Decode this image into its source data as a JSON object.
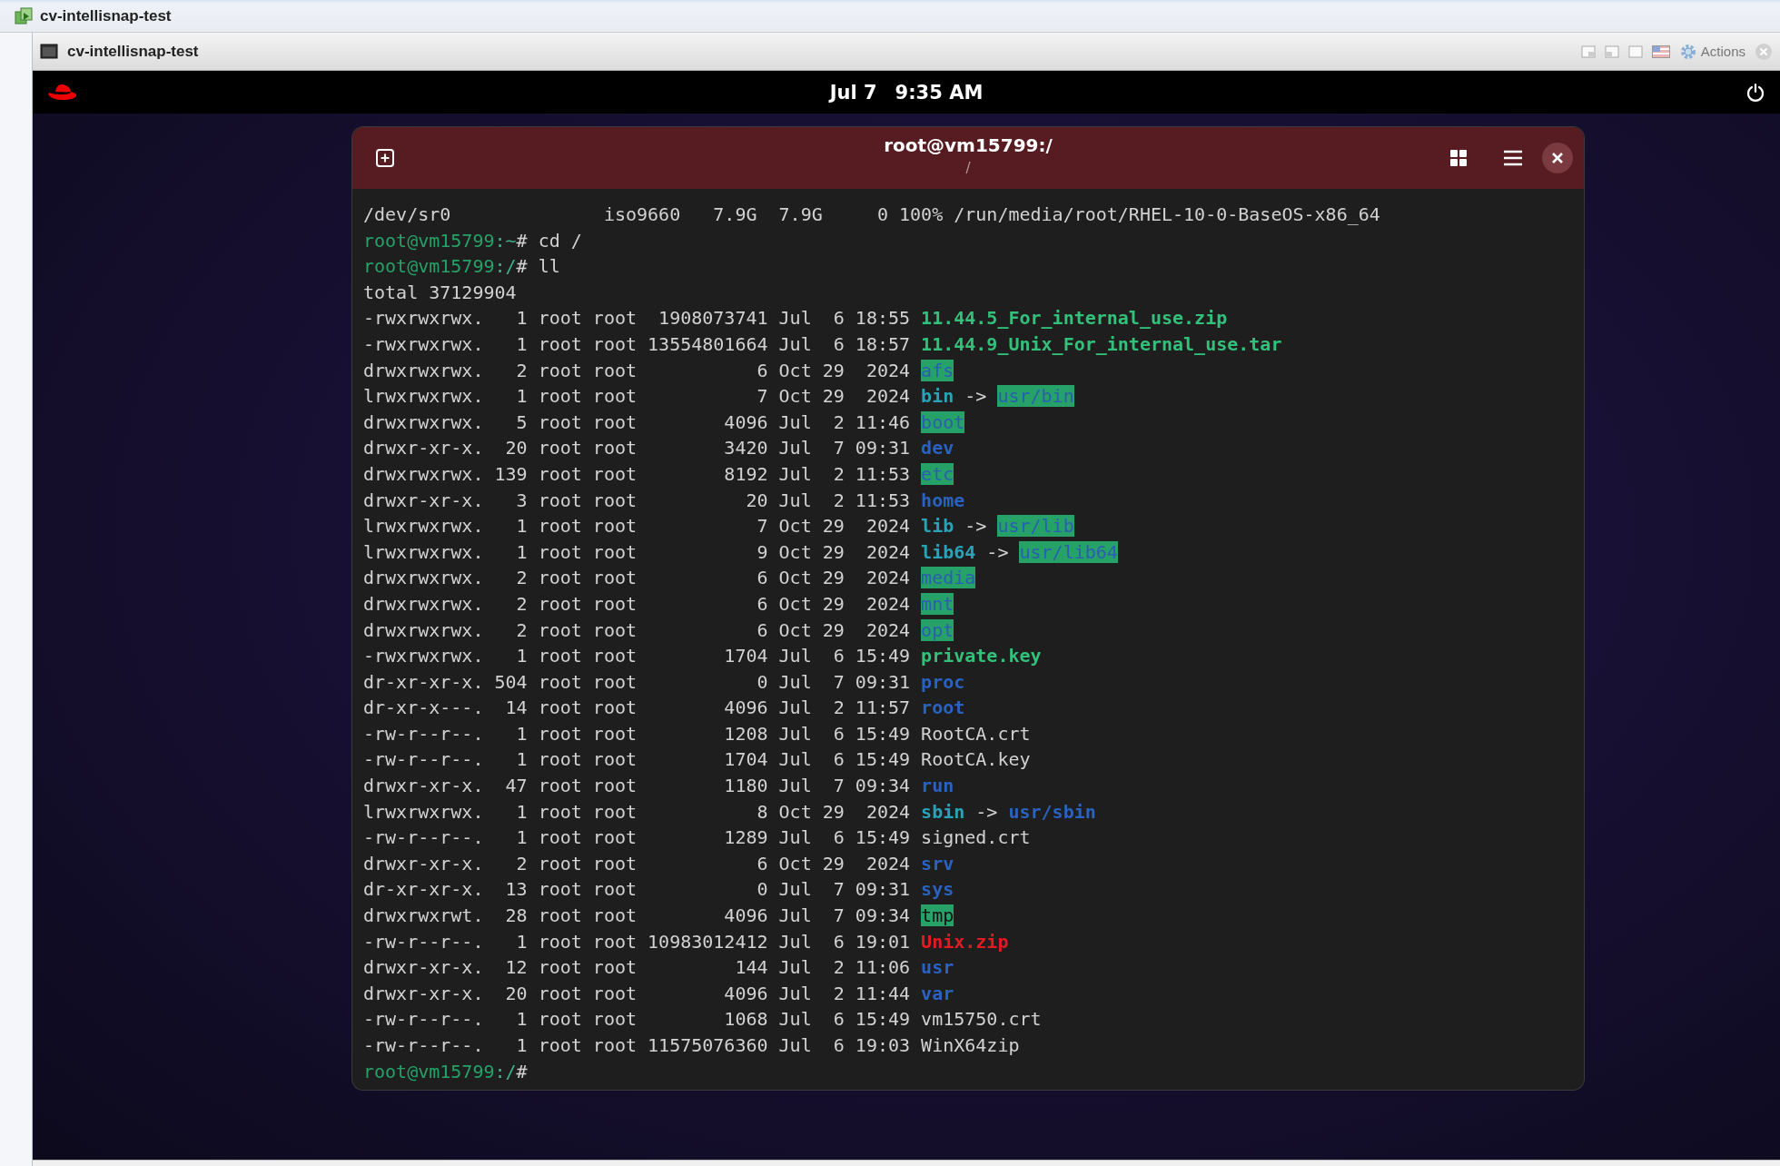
{
  "window": {
    "title": "cv-intellisnap-test"
  },
  "vm_window": {
    "title": "cv-intellisnap-test",
    "actions_label": "Actions"
  },
  "top_bar": {
    "date": "Jul 7",
    "time": "9:35 AM"
  },
  "terminal": {
    "title": "root@vm15799:/",
    "subtitle": "/",
    "lines": [
      [
        {
          "text": "/dev/sr0              iso9660   7.9G  7.9G     0 100% /run/media/root/RHEL-10-0-BaseOS-x86_64",
          "kind": "plain"
        }
      ],
      [
        {
          "text": "root@vm15799",
          "kind": "prompt-user"
        },
        {
          "text": ":~",
          "kind": "prompt-path"
        },
        {
          "text": "# cd /",
          "kind": "plain"
        }
      ],
      [
        {
          "text": "root@vm15799",
          "kind": "prompt-user"
        },
        {
          "text": ":/",
          "kind": "prompt-path"
        },
        {
          "text": "# ll",
          "kind": "plain"
        }
      ],
      [
        {
          "text": "total 37129904",
          "kind": "plain"
        }
      ],
      [
        {
          "text": "-rwxrwxrwx.   1 root root  1908073741 Jul  6 18:55 ",
          "kind": "plain"
        },
        {
          "text": "11.44.5_For_internal_use.zip",
          "kind": "exec"
        }
      ],
      [
        {
          "text": "-rwxrwxrwx.   1 root root 13554801664 Jul  6 18:57 ",
          "kind": "plain"
        },
        {
          "text": "11.44.9_Unix_For_internal_use.tar",
          "kind": "exec"
        }
      ],
      [
        {
          "text": "drwxrwxrwx.   2 root root           6 Oct 29  2024 ",
          "kind": "plain"
        },
        {
          "text": "afs",
          "kind": "dir-other"
        }
      ],
      [
        {
          "text": "lrwxrwxrwx.   1 root root           7 Oct 29  2024 ",
          "kind": "plain"
        },
        {
          "text": "bin",
          "kind": "link"
        },
        {
          "text": " -> ",
          "kind": "plain"
        },
        {
          "text": "usr/bin",
          "kind": "dir-other"
        }
      ],
      [
        {
          "text": "drwxrwxrwx.   5 root root        4096 Jul  2 11:46 ",
          "kind": "plain"
        },
        {
          "text": "boot",
          "kind": "dir-other"
        }
      ],
      [
        {
          "text": "drwxr-xr-x.  20 root root        3420 Jul  7 09:31 ",
          "kind": "plain"
        },
        {
          "text": "dev",
          "kind": "dir"
        }
      ],
      [
        {
          "text": "drwxrwxrwx. 139 root root        8192 Jul  2 11:53 ",
          "kind": "plain"
        },
        {
          "text": "etc",
          "kind": "dir-other"
        }
      ],
      [
        {
          "text": "drwxr-xr-x.   3 root root          20 Jul  2 11:53 ",
          "kind": "plain"
        },
        {
          "text": "home",
          "kind": "dir"
        }
      ],
      [
        {
          "text": "lrwxrwxrwx.   1 root root           7 Oct 29  2024 ",
          "kind": "plain"
        },
        {
          "text": "lib",
          "kind": "link"
        },
        {
          "text": " -> ",
          "kind": "plain"
        },
        {
          "text": "usr/lib",
          "kind": "dir-other"
        }
      ],
      [
        {
          "text": "lrwxrwxrwx.   1 root root           9 Oct 29  2024 ",
          "kind": "plain"
        },
        {
          "text": "lib64",
          "kind": "link"
        },
        {
          "text": " -> ",
          "kind": "plain"
        },
        {
          "text": "usr/lib64",
          "kind": "dir-other"
        }
      ],
      [
        {
          "text": "drwxrwxrwx.   2 root root           6 Oct 29  2024 ",
          "kind": "plain"
        },
        {
          "text": "media",
          "kind": "dir-other"
        }
      ],
      [
        {
          "text": "drwxrwxrwx.   2 root root           6 Oct 29  2024 ",
          "kind": "plain"
        },
        {
          "text": "mnt",
          "kind": "dir-other"
        }
      ],
      [
        {
          "text": "drwxrwxrwx.   2 root root           6 Oct 29  2024 ",
          "kind": "plain"
        },
        {
          "text": "opt",
          "kind": "dir-other"
        }
      ],
      [
        {
          "text": "-rwxrwxrwx.   1 root root        1704 Jul  6 15:49 ",
          "kind": "plain"
        },
        {
          "text": "private.key",
          "kind": "exec"
        }
      ],
      [
        {
          "text": "dr-xr-xr-x. 504 root root           0 Jul  7 09:31 ",
          "kind": "plain"
        },
        {
          "text": "proc",
          "kind": "dir"
        }
      ],
      [
        {
          "text": "dr-xr-x---.  14 root root        4096 Jul  2 11:57 ",
          "kind": "plain"
        },
        {
          "text": "root",
          "kind": "dir"
        }
      ],
      [
        {
          "text": "-rw-r--r--.   1 root root        1208 Jul  6 15:49 RootCA.crt",
          "kind": "plain"
        }
      ],
      [
        {
          "text": "-rw-r--r--.   1 root root        1704 Jul  6 15:49 RootCA.key",
          "kind": "plain"
        }
      ],
      [
        {
          "text": "drwxr-xr-x.  47 root root        1180 Jul  7 09:34 ",
          "kind": "plain"
        },
        {
          "text": "run",
          "kind": "dir"
        }
      ],
      [
        {
          "text": "lrwxrwxrwx.   1 root root           8 Oct 29  2024 ",
          "kind": "plain"
        },
        {
          "text": "sbin",
          "kind": "link"
        },
        {
          "text": " -> ",
          "kind": "plain"
        },
        {
          "text": "usr/sbin",
          "kind": "dir"
        }
      ],
      [
        {
          "text": "-rw-r--r--.   1 root root        1289 Jul  6 15:49 signed.crt",
          "kind": "plain"
        }
      ],
      [
        {
          "text": "drwxr-xr-x.   2 root root           6 Oct 29  2024 ",
          "kind": "plain"
        },
        {
          "text": "srv",
          "kind": "dir"
        }
      ],
      [
        {
          "text": "dr-xr-xr-x.  13 root root           0 Jul  7 09:31 ",
          "kind": "plain"
        },
        {
          "text": "sys",
          "kind": "dir"
        }
      ],
      [
        {
          "text": "drwxrwxrwt.  28 root root        4096 Jul  7 09:34 ",
          "kind": "plain"
        },
        {
          "text": "tmp",
          "kind": "sticky"
        }
      ],
      [
        {
          "text": "-rw-r--r--.   1 root root 10983012412 Jul  6 19:01 ",
          "kind": "plain"
        },
        {
          "text": "Unix.zip",
          "kind": "archive"
        }
      ],
      [
        {
          "text": "drwxr-xr-x.  12 root root         144 Jul  2 11:06 ",
          "kind": "plain"
        },
        {
          "text": "usr",
          "kind": "dir"
        }
      ],
      [
        {
          "text": "drwxr-xr-x.  20 root root        4096 Jul  2 11:44 ",
          "kind": "plain"
        },
        {
          "text": "var",
          "kind": "dir"
        }
      ],
      [
        {
          "text": "-rw-r--r--.   1 root root        1068 Jul  6 15:49 vm15750.crt",
          "kind": "plain"
        }
      ],
      [
        {
          "text": "-rw-r--r--.   1 root root 11575076360 Jul  6 19:03 WinX64zip",
          "kind": "plain"
        }
      ],
      [
        {
          "text": "root@vm15799",
          "kind": "prompt-user"
        },
        {
          "text": ":/",
          "kind": "prompt-path"
        },
        {
          "text": "#",
          "kind": "plain"
        }
      ]
    ]
  }
}
